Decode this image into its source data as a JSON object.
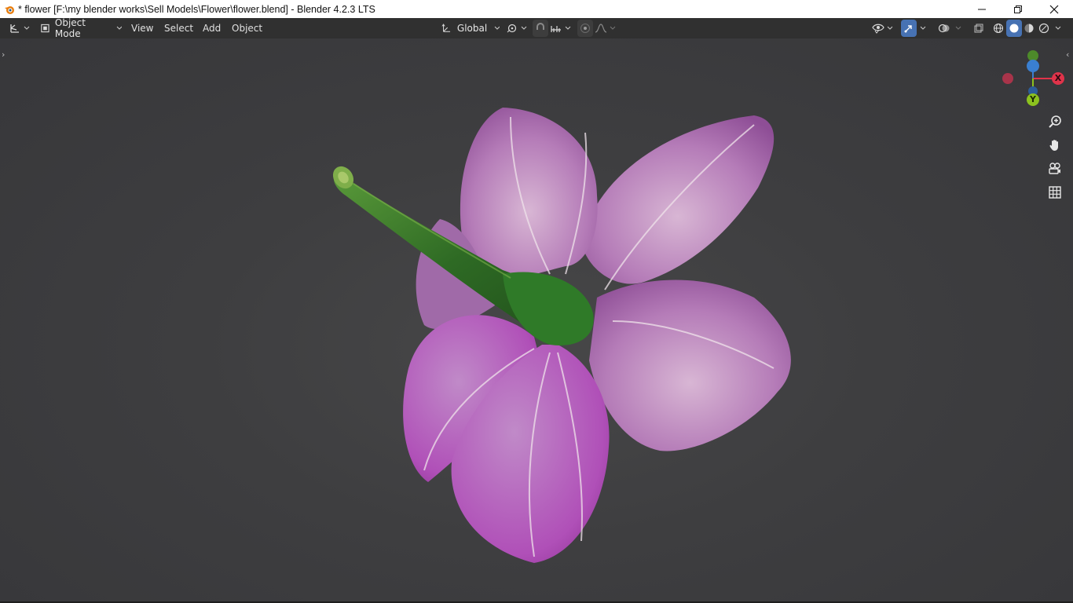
{
  "window": {
    "title": "* flower [F:\\my blender works\\Sell Models\\Flower\\flower.blend] - Blender 4.2.3 LTS"
  },
  "header": {
    "mode_label": "Object Mode",
    "menus": [
      "View",
      "Select",
      "Add",
      "Object"
    ],
    "transform_orientation": "Global"
  },
  "gizmo": {
    "x_label": "X",
    "y_label": "Y",
    "colors": {
      "x": "#e0334a",
      "y": "#8cc21f",
      "z": "#3a7fd1"
    }
  },
  "icons": [
    "editor-type-icon",
    "object-mode-icon",
    "transform-orientation-icon",
    "pivot-icon",
    "snap-icon",
    "snap-increment-icon",
    "proportional-edit-icon",
    "falloff-icon",
    "visibility-icon",
    "gizmo-icon",
    "overlay-icon",
    "xray-icon",
    "wireframe-shading-icon",
    "solid-shading-icon",
    "material-shading-icon",
    "rendered-shading-icon",
    "zoom-icon",
    "hand-icon",
    "camera-icon",
    "grid-icon"
  ]
}
